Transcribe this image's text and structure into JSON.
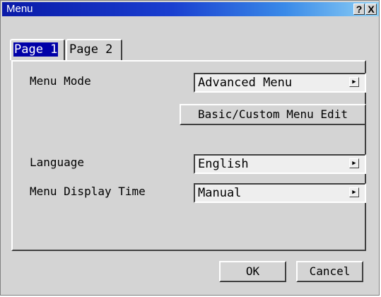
{
  "window": {
    "title": "Menu",
    "help_button": "?",
    "close_button": "X"
  },
  "tabs": [
    {
      "label": "Page 1",
      "active": true
    },
    {
      "label": "Page 2",
      "active": false
    }
  ],
  "settings": {
    "menu_mode": {
      "label": "Menu Mode",
      "value": "Advanced Menu"
    },
    "edit_button": "Basic/Custom Menu Edit",
    "language": {
      "label": "Language",
      "value": "English"
    },
    "display_time": {
      "label": "Menu Display Time",
      "value": "Manual"
    }
  },
  "icons": {
    "dropdown_arrow": "▶"
  },
  "footer": {
    "ok_label": "OK",
    "cancel_label": "Cancel"
  },
  "colors": {
    "title_start": "#0a1aa8",
    "title_end": "#8ed0f5",
    "active_tab_highlight": "#0000a8",
    "window_bg": "#d4d4d4"
  }
}
